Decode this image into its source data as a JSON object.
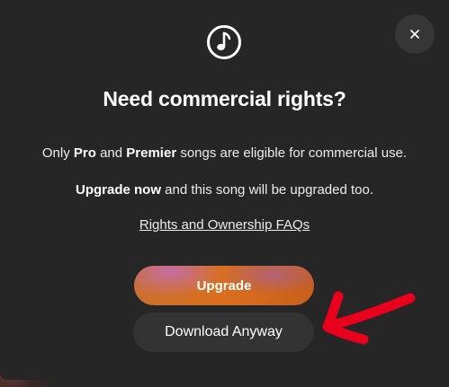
{
  "dialog": {
    "title": "Need commercial rights?",
    "line1": {
      "prefix": "Only ",
      "pro": "Pro",
      "middle": " and ",
      "premier": "Premier",
      "suffix": " songs are eligible for commercial use."
    },
    "line2": {
      "bold": "Upgrade now",
      "suffix": " and this song will be upgraded too."
    },
    "faq_link": "Rights and Ownership FAQs",
    "close_icon": "close-icon",
    "header_icon": "music-note-icon"
  },
  "actions": {
    "upgrade_label": "Upgrade",
    "download_label": "Download Anyway"
  },
  "annotation": {
    "arrow_color": "#e8001c",
    "arrow_icon": "arrow-left-icon"
  },
  "colors": {
    "modal_bg": "#262626",
    "close_bg": "#363636",
    "download_bg": "#333333",
    "upgrade_orange": "#d96f1d",
    "upgrade_pink": "#c46eaa"
  }
}
